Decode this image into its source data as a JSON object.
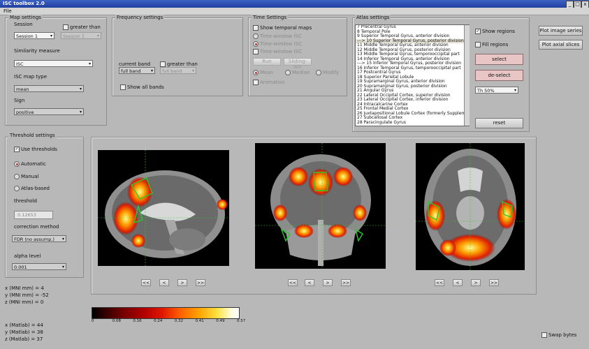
{
  "window": {
    "title": "ISC toolbox 2.0",
    "min_btn": "_",
    "max_btn": "□",
    "close_btn": "x"
  },
  "menu": {
    "file": "File"
  },
  "map_settings": {
    "title": "Map settings",
    "session_label": "Session",
    "session_value": "Session 1",
    "greater_than_label": "greater than",
    "greater_than_value": "Session 1",
    "similarity_label": "Similarity measure",
    "similarity_value": "ISC",
    "map_type_label": "ISC map type",
    "map_type_value": "mean",
    "sign_label": "Sign",
    "sign_value": "positive"
  },
  "frequency_settings": {
    "title": "Frequency settings",
    "current_band_label": "current band",
    "current_band_value": "full band",
    "greater_than_label": "greater than",
    "greater_than_value": "full band",
    "show_all_bands": "Show all bands"
  },
  "time_settings": {
    "title": "Time Settings",
    "show_temporal_maps": "Show temporal maps",
    "opt1": "Time-window ISC",
    "opt2": "Time-window ISC",
    "opt3": "Time-window ISC",
    "btn_left": "Run",
    "btn_right": "Sliding-win",
    "r1": "Mean",
    "r2": "Median",
    "r3": "Modify",
    "cb_bottom": "Animation"
  },
  "atlas": {
    "title": "Atlas settings",
    "items": [
      "7 Precentral Gyrus",
      "8 Temporal Pole",
      "9 Superior Temporal Gyrus, anterior division",
      "---> 10 Superior Temporal Gyrus, posterior division",
      "11 Middle Temporal Gyrus, anterior division",
      "12 Middle Temporal Gyrus, posterior division",
      "13 Middle Temporal Gyrus, temporooccipital part",
      "14 Inferior Temporal Gyrus, anterior division",
      "---> 15 Inferior Temporal Gyrus, posterior division",
      "16 Inferior Temporal Gyrus, temporooccipital part",
      "17 Postcentral Gyrus",
      "18 Superior Parietal Lobule",
      "19 Supramarginal Gyrus, anterior division",
      "20 Supramarginal Gyrus, posterior division",
      "21 Angular Gyrus",
      "22 Lateral Occipital Cortex, superior division",
      "23 Lateral Occipital Cortex, inferior division",
      "24 Intracalcarine Cortex",
      "25 Frontal Medial Cortex",
      "26 Juxtapositional Lobule Cortex (formerly Supplementa",
      "27 Subcallosal Cortex",
      "28 Paracingulate Gyrus"
    ],
    "show_regions": "Show regions",
    "fill_regions": "Fill regions",
    "select": "select",
    "deselect": "de-select",
    "threshold_value": "Th 50%",
    "reset": "reset"
  },
  "plots": {
    "image_series": "Plot image series",
    "axial_slices": "Plot axial slices"
  },
  "threshold": {
    "title": "Threshold settings",
    "use_thresholds": "Use thresholds",
    "automatic": "Automatic",
    "manual": "Manual",
    "atlas_based": "Atlas-based",
    "threshold_label": "threshold",
    "threshold_value": "0.12653",
    "correction_label": "correction method",
    "correction_value": "FDR (no assump.)",
    "alpha_label": "alpha level",
    "alpha_value": "0.001"
  },
  "coords": {
    "x_mni": "x (MNI mm) = 4",
    "y_mni": "y (MNI mm) = -52",
    "z_mni": "z (MNI mm) = 0",
    "x_mat": "x (Matlab) = 44",
    "y_mat": "y (Matlab) = 38",
    "z_mat": "z (Matlab) = 37"
  },
  "nav": {
    "first": "<<",
    "prev": "<",
    "next": ">",
    "last": ">>"
  },
  "colorbar": {
    "ticks": [
      "0",
      "0.08",
      "0.16",
      "0.24",
      "0.32",
      "0.41",
      "0.49",
      "0.57"
    ]
  },
  "swap_bytes": "Swap bytes"
}
